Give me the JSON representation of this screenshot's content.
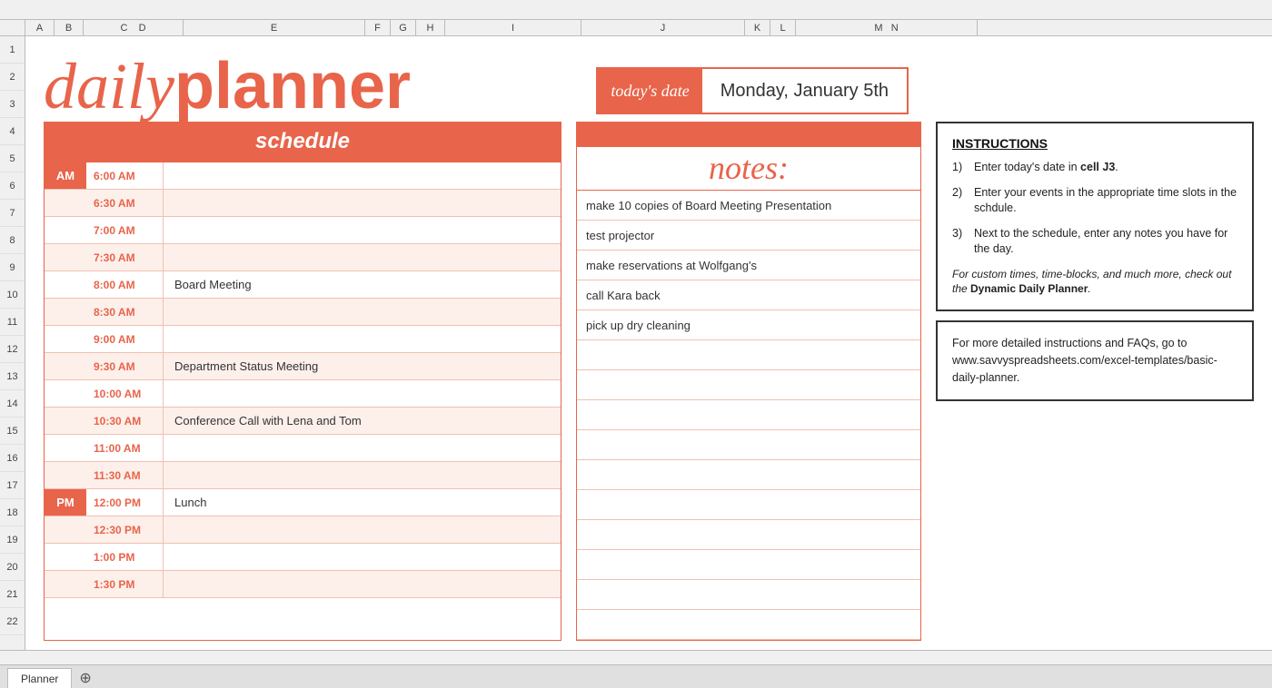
{
  "header": {
    "formula_bar_text": "",
    "col_headers": [
      "A",
      "B",
      "C",
      "D",
      "E",
      "F",
      "G",
      "H",
      "I",
      "J",
      "K",
      "L",
      "M",
      "N"
    ],
    "row_numbers": [
      2,
      3,
      4,
      5,
      6,
      7,
      8,
      9,
      10,
      11,
      12,
      13,
      14,
      15,
      16,
      17,
      18,
      19,
      20,
      21,
      22
    ]
  },
  "logo": {
    "daily": "daily",
    "planner": "planner"
  },
  "date_section": {
    "label": "today's date",
    "value": "Monday, January 5th"
  },
  "schedule": {
    "header": "schedule",
    "rows": [
      {
        "am_pm": "AM",
        "am_pm_class": "am",
        "time": "6:00 AM",
        "event": "",
        "shaded": false
      },
      {
        "am_pm": "",
        "am_pm_class": "empty",
        "time": "6:30 AM",
        "event": "",
        "shaded": true
      },
      {
        "am_pm": "",
        "am_pm_class": "empty",
        "time": "7:00 AM",
        "event": "",
        "shaded": false
      },
      {
        "am_pm": "",
        "am_pm_class": "empty",
        "time": "7:30 AM",
        "event": "",
        "shaded": true
      },
      {
        "am_pm": "",
        "am_pm_class": "empty",
        "time": "8:00 AM",
        "event": "Board Meeting",
        "shaded": false
      },
      {
        "am_pm": "",
        "am_pm_class": "empty",
        "time": "8:30 AM",
        "event": "",
        "shaded": true
      },
      {
        "am_pm": "",
        "am_pm_class": "empty",
        "time": "9:00 AM",
        "event": "",
        "shaded": false
      },
      {
        "am_pm": "",
        "am_pm_class": "empty",
        "time": "9:30 AM",
        "event": "Department Status Meeting",
        "shaded": true
      },
      {
        "am_pm": "",
        "am_pm_class": "empty",
        "time": "10:00 AM",
        "event": "",
        "shaded": false
      },
      {
        "am_pm": "",
        "am_pm_class": "empty",
        "time": "10:30 AM",
        "event": "Conference Call with Lena and Tom",
        "shaded": true
      },
      {
        "am_pm": "",
        "am_pm_class": "empty",
        "time": "11:00 AM",
        "event": "",
        "shaded": false
      },
      {
        "am_pm": "",
        "am_pm_class": "empty",
        "time": "11:30 AM",
        "event": "",
        "shaded": true
      },
      {
        "am_pm": "PM",
        "am_pm_class": "pm",
        "time": "12:00 PM",
        "event": "Lunch",
        "shaded": false
      },
      {
        "am_pm": "",
        "am_pm_class": "empty",
        "time": "12:30 PM",
        "event": "",
        "shaded": true
      },
      {
        "am_pm": "",
        "am_pm_class": "empty",
        "time": "1:00 PM",
        "event": "",
        "shaded": false
      },
      {
        "am_pm": "",
        "am_pm_class": "empty",
        "time": "1:30 PM",
        "event": "",
        "shaded": true
      }
    ]
  },
  "notes": {
    "title": "notes:",
    "items": [
      "make 10 copies of Board Meeting Presentation",
      "test projector",
      "make reservations at Wolfgang's",
      "call Kara back",
      "pick up dry cleaning",
      "",
      "",
      "",
      "",
      "",
      "",
      "",
      "",
      "",
      ""
    ]
  },
  "instructions": {
    "title": "INSTRUCTIONS",
    "steps": [
      {
        "num": "1)",
        "text": "Enter today's date in ",
        "bold": "cell J3",
        "after": "."
      },
      {
        "num": "2)",
        "text": "Enter your events in the appropriate time slots in the schdule.",
        "bold": "",
        "after": ""
      },
      {
        "num": "3)",
        "text": "Next to the schedule, enter any notes you have for the day.",
        "bold": "",
        "after": ""
      }
    ],
    "italic_text": "For custom times, time-blocks, and much more, check out the ",
    "italic_bold": "Dynamic Daily Planner",
    "italic_end": "."
  },
  "more_info": {
    "text": "For more detailed instructions and FAQs, go to www.savvyspreadsheets.com/excel-templates/basic-daily-planner."
  },
  "tab": {
    "name": "Planner"
  }
}
